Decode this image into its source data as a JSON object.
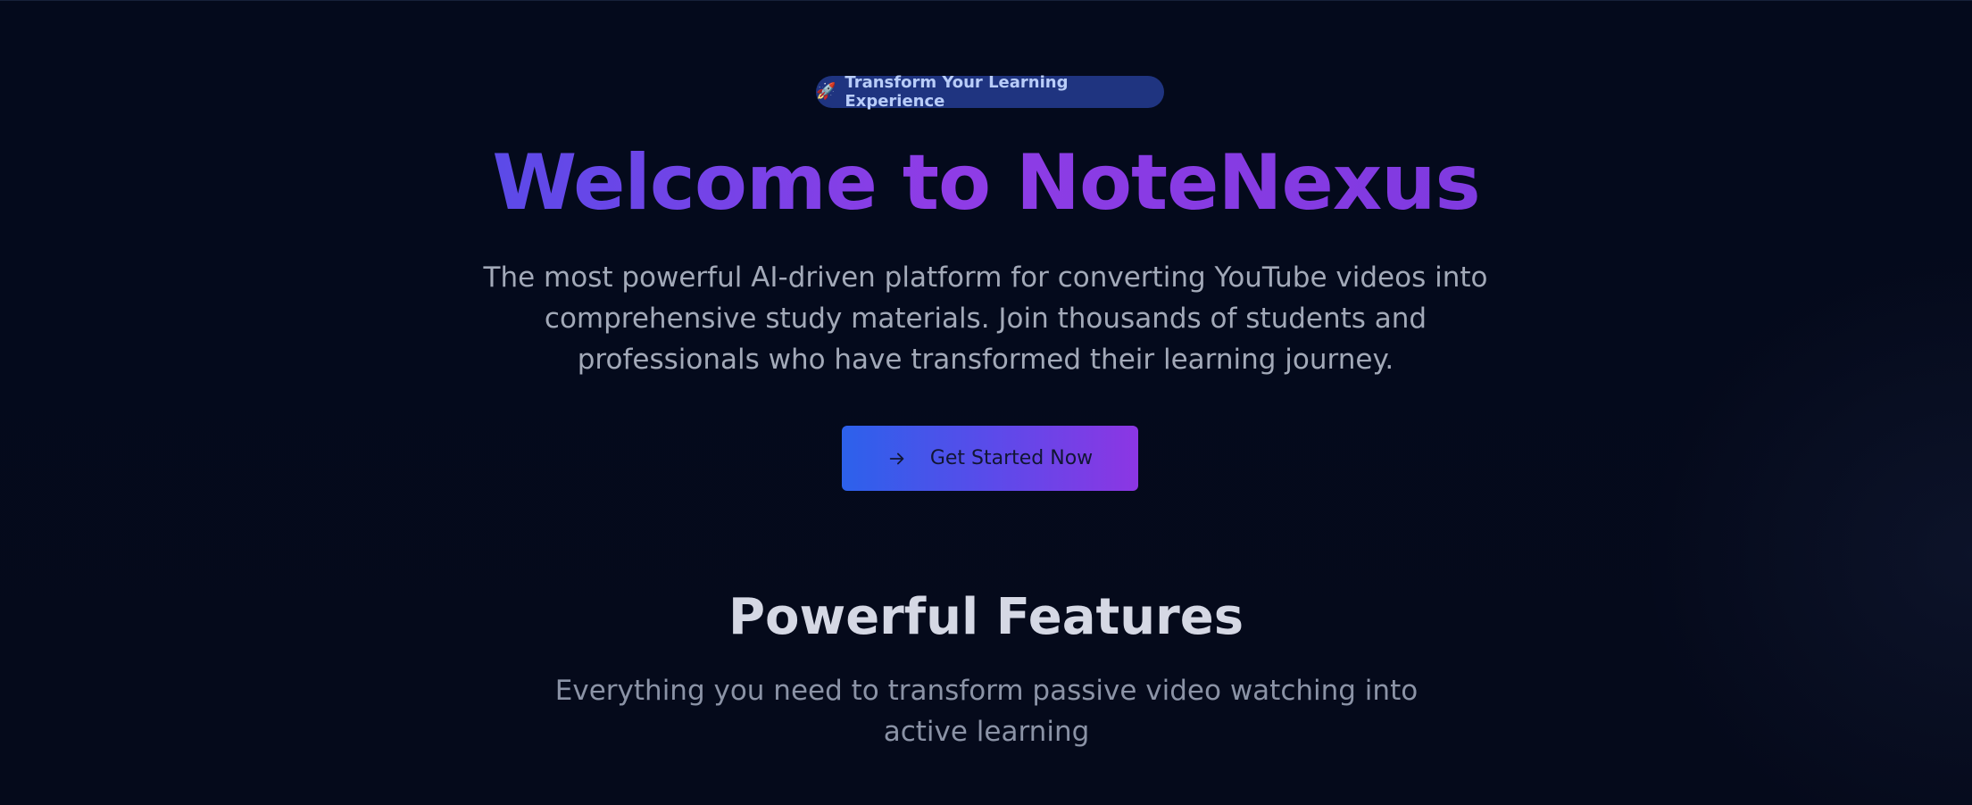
{
  "hero": {
    "badge": {
      "icon": "rocket-icon",
      "text": "Transform Your Learning Experience"
    },
    "title": "Welcome to NoteNexus",
    "subtitle": "The most powerful AI-driven platform for converting YouTube videos into comprehensive study materials. Join thousands of students and professionals who have transformed their learning journey.",
    "cta": {
      "icon": "arrow-right-icon",
      "label": "Get Started Now"
    }
  },
  "features": {
    "title": "Powerful Features",
    "subtitle": "Everything you need to transform passive video watching into active learning"
  },
  "colors": {
    "background": "#050a1a",
    "badge_bg": "#1f3480",
    "badge_text": "#b9cdf9",
    "title_gradient_start": "#5b4ae8",
    "title_gradient_end": "#8f3ce6",
    "cta_gradient_start": "#2c61eb",
    "cta_gradient_end": "#8c36e3",
    "body_text": "#a2a9b8"
  }
}
